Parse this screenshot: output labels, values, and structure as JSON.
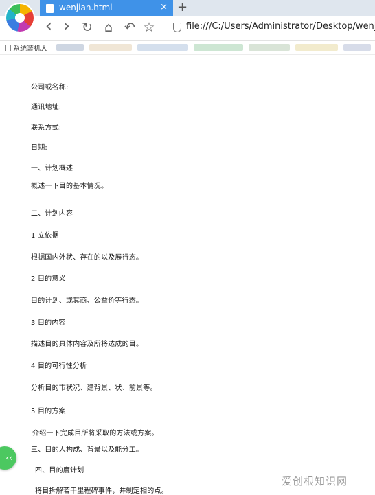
{
  "browser": {
    "tab_title": "wenjian.html",
    "tab_close": "×",
    "new_tab": "+",
    "url": "file:///C:/Users/Administrator/Desktop/wenjia",
    "nav": {
      "back": "‹",
      "forward": "›",
      "reload": "↻",
      "home": "⌂",
      "undo": "↶",
      "star": "☆"
    }
  },
  "bookmarks": {
    "first": "系统装机大"
  },
  "document": {
    "lines": [
      "公司或名称:",
      "通讯地址:",
      "联系方式:",
      "日期:",
      "一、计划概述",
      "概述一下目的基本情况。",
      "二、计划内容",
      "1  立依据",
      "根据国内外状、存在的以及展行态。",
      "2  目的意义",
      "目的计划、或其商、公益价等行态。",
      "3  目的内容",
      "描述目的具体内容及所将达成的目。",
      "4  目的可行性分析",
      "分析目的市状况、建背景、状、前景等。",
      "5  目的方案",
      "介绍一下完成目所将采取的方法或方案。",
      "三、目的人构成、背景以及能分工。",
      "四、目的度计划",
      "将目拆解若干里程碑事件，并制定相的点。"
    ]
  },
  "float_button": {
    "label": "‹‹"
  },
  "watermark": "爱创根知识网",
  "colors": {
    "tab": "#3f92e8",
    "titlebar": "#dfe6ee",
    "float": "#4cc860"
  }
}
